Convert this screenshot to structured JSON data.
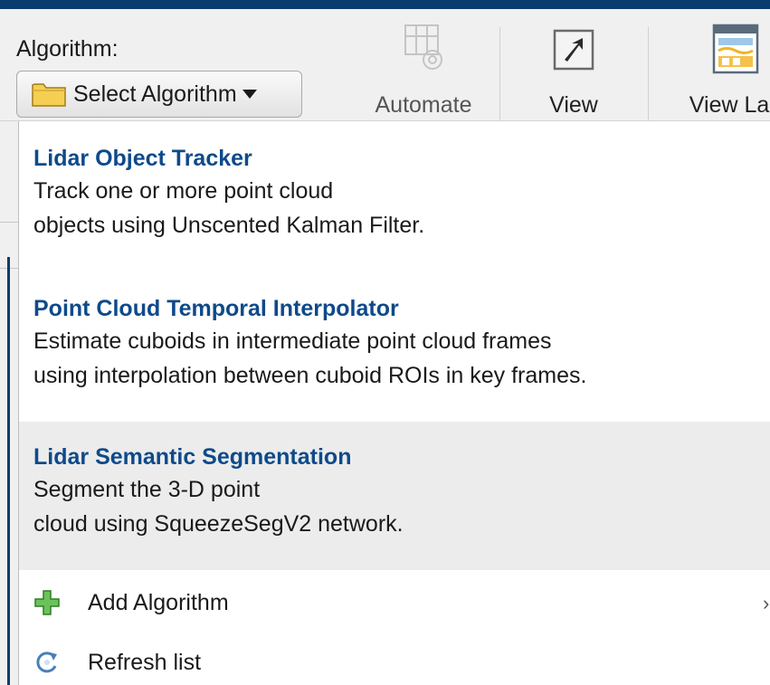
{
  "toolstrip": {
    "algorithm_label": "Algorithm:",
    "select_button_label": "Select Algorithm",
    "automate_label": "Automate",
    "view_label": "View",
    "view_labels_label": "View Lab"
  },
  "menu": {
    "items": [
      {
        "title": "Lidar Object Tracker",
        "desc_line1": "Track one or more point cloud",
        "desc_line2": "objects using Unscented Kalman Filter."
      },
      {
        "title": "Point Cloud Temporal Interpolator",
        "desc_line1": "Estimate cuboids in intermediate point cloud frames",
        "desc_line2": "using interpolation between cuboid ROIs in key frames."
      },
      {
        "title": "Lidar Semantic Segmentation",
        "desc_line1": "Segment the 3-D point",
        "desc_line2": "cloud using SqueezeSegV2 network."
      }
    ],
    "actions": {
      "add_label": "Add Algorithm",
      "refresh_label": "Refresh list"
    }
  },
  "colors": {
    "title_blue": "#0e4a8a",
    "top_bar": "#0b3c6e",
    "hover_row": "#ececec",
    "add_icon_green": "#3fa535"
  },
  "icons": [
    "folder-icon",
    "caret-down-icon",
    "automate-icon",
    "view-arrow-icon",
    "view-labels-icon",
    "add-plus-icon",
    "refresh-icon",
    "submenu-chevron-icon"
  ]
}
